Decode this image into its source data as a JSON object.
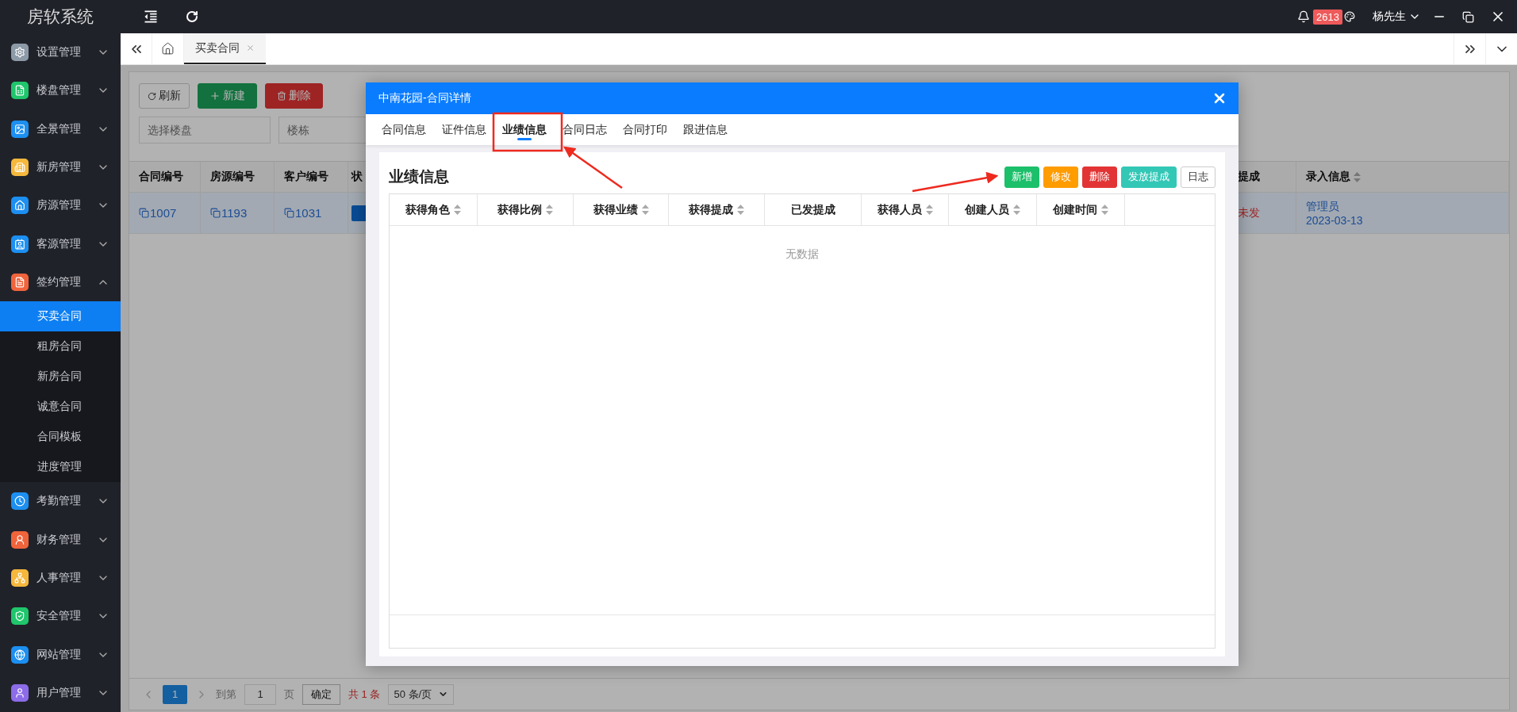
{
  "app": {
    "title": "房软系统"
  },
  "topbar": {
    "notification_count": "2613",
    "user": "杨先生"
  },
  "sidebar": {
    "items": [
      {
        "label": "设置管理",
        "color": "#8d9aa7",
        "expanded": false
      },
      {
        "label": "楼盘管理",
        "color": "#1fc66b",
        "expanded": false
      },
      {
        "label": "全景管理",
        "color": "#1c8ff0",
        "expanded": false
      },
      {
        "label": "新房管理",
        "color": "#f5b83d",
        "expanded": false
      },
      {
        "label": "房源管理",
        "color": "#1c8ff0",
        "expanded": false
      },
      {
        "label": "客源管理",
        "color": "#1c8ff0",
        "expanded": false
      },
      {
        "label": "签约管理",
        "color": "#f0643c",
        "expanded": true,
        "children": [
          {
            "label": "买卖合同",
            "selected": true
          },
          {
            "label": "租房合同",
            "selected": false
          },
          {
            "label": "新房合同",
            "selected": false
          },
          {
            "label": "诚意合同",
            "selected": false
          },
          {
            "label": "合同模板",
            "selected": false
          },
          {
            "label": "进度管理",
            "selected": false
          }
        ]
      },
      {
        "label": "考勤管理",
        "color": "#1c8ff0",
        "expanded": false
      },
      {
        "label": "财务管理",
        "color": "#f0643c",
        "expanded": false
      },
      {
        "label": "人事管理",
        "color": "#f5b83d",
        "expanded": false
      },
      {
        "label": "安全管理",
        "color": "#1fc66b",
        "expanded": false
      },
      {
        "label": "网站管理",
        "color": "#1c8ff0",
        "expanded": false
      },
      {
        "label": "用户管理",
        "color": "#8c6ce8",
        "expanded": false
      }
    ]
  },
  "tabs": [
    {
      "label": "买卖合同",
      "selected": true
    }
  ],
  "toolbar": {
    "buttons": [
      {
        "label": "刷新",
        "kind": "default"
      },
      {
        "label": "新建",
        "kind": "primary"
      },
      {
        "label": "删除",
        "kind": "danger"
      }
    ],
    "filters": [
      {
        "placeholder": "选择楼盘"
      },
      {
        "placeholder": "楼栋"
      }
    ]
  },
  "table": {
    "columns": [
      {
        "label": "合同编号",
        "sortable": false
      },
      {
        "label": "房源编号",
        "sortable": false
      },
      {
        "label": "客户编号",
        "sortable": false
      },
      {
        "label": "状",
        "sortable": false
      },
      {
        "label": "提成",
        "sortable": false
      },
      {
        "label": "录入信息",
        "sortable": true
      }
    ],
    "rows": [
      {
        "selected": true,
        "cells": [
          {
            "kind": "link",
            "text": "1007"
          },
          {
            "kind": "link",
            "text": "1193"
          },
          {
            "kind": "link",
            "text": "1031"
          },
          {
            "kind": "badge"
          },
          {
            "kind": "status",
            "text": "未发"
          },
          {
            "kind": "info",
            "lines": [
              "管理员",
              "2023-03-13"
            ]
          }
        ]
      }
    ]
  },
  "pagination": {
    "pages": [
      {
        "label": "1",
        "selected": true
      }
    ],
    "goto_label": "到第",
    "page_value": "1",
    "page_suffix": "页",
    "confirm": "确定",
    "total": "共 1 条",
    "page_size": "50 条/页"
  },
  "modal": {
    "title": "中南花园-合同详情",
    "tabs": [
      {
        "label": "合同信息",
        "selected": false
      },
      {
        "label": "证件信息",
        "selected": false
      },
      {
        "label": "业绩信息",
        "selected": true
      },
      {
        "label": "合同日志",
        "selected": false
      },
      {
        "label": "合同打印",
        "selected": false
      },
      {
        "label": "跟进信息",
        "selected": false
      }
    ],
    "section_title": "业绩信息",
    "buttons": [
      {
        "label": "新增",
        "kind": "success"
      },
      {
        "label": "修改",
        "kind": "warning"
      },
      {
        "label": "删除",
        "kind": "danger"
      },
      {
        "label": "发放提成",
        "kind": "info"
      },
      {
        "label": "日志",
        "kind": "default"
      }
    ],
    "columns": [
      {
        "label": "获得角色",
        "sortable": true
      },
      {
        "label": "获得比例",
        "sortable": true
      },
      {
        "label": "获得业绩",
        "sortable": true
      },
      {
        "label": "获得提成",
        "sortable": true
      },
      {
        "label": "已发提成",
        "sortable": false
      },
      {
        "label": "获得人员",
        "sortable": true
      },
      {
        "label": "创建人员",
        "sortable": true
      },
      {
        "label": "创建时间",
        "sortable": true
      }
    ],
    "empty_text": "无数据"
  }
}
